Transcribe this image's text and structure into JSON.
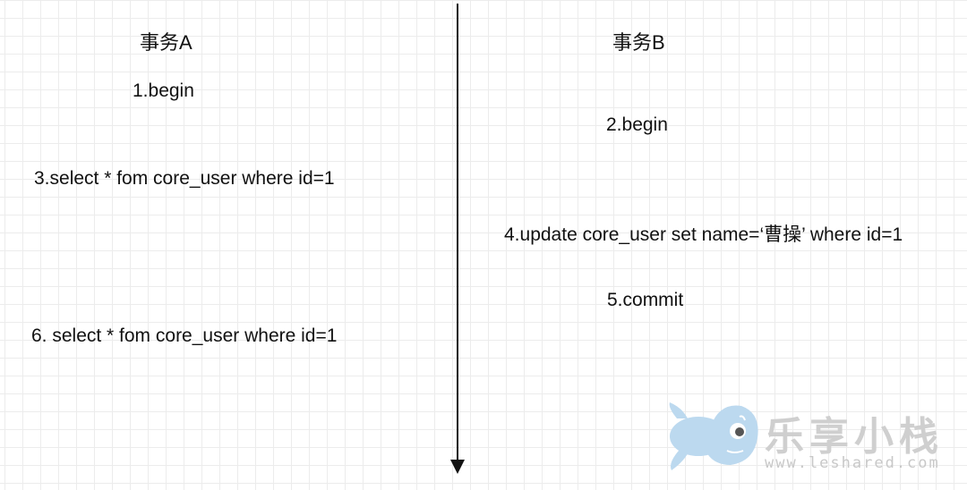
{
  "diagram": {
    "transaction_a": {
      "heading": "事务A",
      "steps": [
        "1.begin",
        "3.select * fom core_user where id=1",
        "6. select * fom core_user where id=1"
      ]
    },
    "transaction_b": {
      "heading": "事务B",
      "steps": [
        "2.begin",
        "4.update core_user set name=‘曹操’ where id=1",
        "5.commit"
      ]
    }
  },
  "watermark": {
    "title": "乐享小栈",
    "url": "www.leshared.com"
  },
  "colors": {
    "grid": "#ececec",
    "text": "#111111",
    "timeline": "#111111",
    "fish": "#bcd9ef",
    "watermark_text": "#cfcfcf"
  }
}
